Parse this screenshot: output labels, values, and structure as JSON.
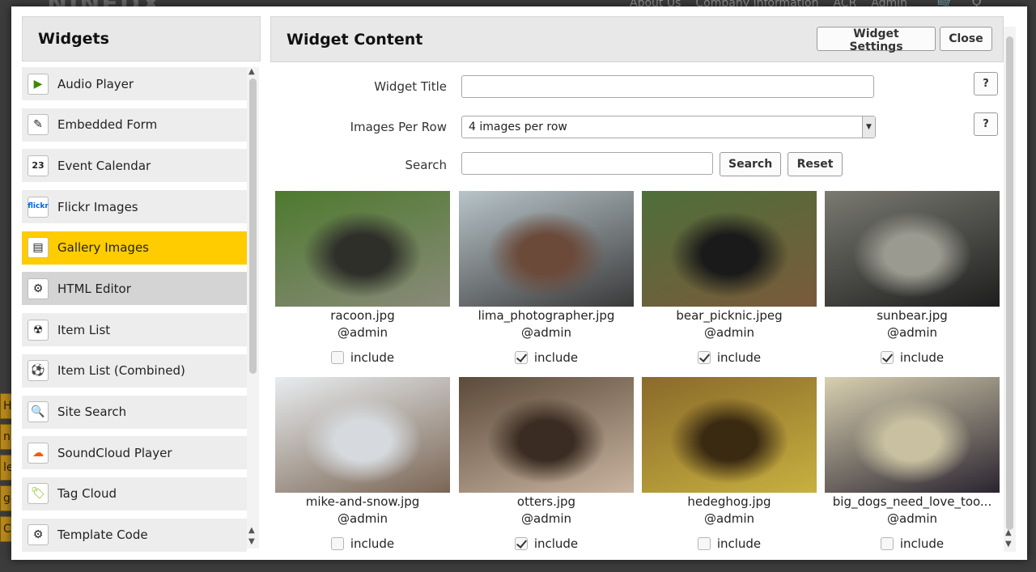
{
  "background": {
    "logo": "NINEDX",
    "nav_links": [
      "About Us",
      "Company Information",
      "ACR",
      "Admin"
    ],
    "side_tabs": [
      "H",
      "nu",
      "let",
      "ge",
      "Cl"
    ]
  },
  "left_panel": {
    "title": "Widgets",
    "items": [
      {
        "label": "Audio Player",
        "icon": "play-icon",
        "state": "normal"
      },
      {
        "label": "Embedded Form",
        "icon": "form-icon",
        "state": "normal"
      },
      {
        "label": "Event Calendar",
        "icon": "calendar-icon",
        "state": "normal"
      },
      {
        "label": "Flickr Images",
        "icon": "flickr-icon",
        "state": "normal"
      },
      {
        "label": "Gallery Images",
        "icon": "gallery-icon",
        "state": "active"
      },
      {
        "label": "HTML Editor",
        "icon": "html-editor-icon",
        "state": "hover"
      },
      {
        "label": "Item List",
        "icon": "item-list-icon",
        "state": "normal"
      },
      {
        "label": "Item List (Combined)",
        "icon": "item-list-combined-icon",
        "state": "normal"
      },
      {
        "label": "Site Search",
        "icon": "search-icon",
        "state": "normal"
      },
      {
        "label": "SoundCloud Player",
        "icon": "soundcloud-icon",
        "state": "normal"
      },
      {
        "label": "Tag Cloud",
        "icon": "tag-icon",
        "state": "normal"
      },
      {
        "label": "Template Code",
        "icon": "template-code-icon",
        "state": "normal"
      }
    ],
    "icon_glyphs": {
      "play-icon": "▶",
      "form-icon": "✎",
      "calendar-icon": "23",
      "flickr-icon": "flickr",
      "gallery-icon": "▤",
      "html-editor-icon": "⚙",
      "item-list-icon": "☢",
      "item-list-combined-icon": "⚽",
      "search-icon": "🔍",
      "soundcloud-icon": "☁",
      "tag-icon": "🏷",
      "template-code-icon": "⚙"
    }
  },
  "right_panel": {
    "title": "Widget Content",
    "settings_label": "Widget Settings",
    "close_label": "Close",
    "widget_title_label": "Widget Title",
    "widget_title_value": "",
    "images_per_row_label": "Images Per Row",
    "images_per_row_value": "4 images per row",
    "search_label": "Search",
    "search_value": "",
    "search_button": "Search",
    "reset_button": "Reset",
    "help_label": "?",
    "include_label": "include",
    "images": [
      {
        "filename": "racoon.jpg",
        "owner": "@admin",
        "included": false,
        "colors": [
          "#4d7a2e",
          "#8a8a7a",
          "#2f2f2a"
        ]
      },
      {
        "filename": "lima_photographer.jpg",
        "owner": "@admin",
        "included": true,
        "colors": [
          "#b8c4c9",
          "#3a3a3a",
          "#6c4a3a"
        ]
      },
      {
        "filename": "bear_picknic.jpeg",
        "owner": "@admin",
        "included": true,
        "colors": [
          "#4e6f3a",
          "#7a5a3a",
          "#1a1a1a"
        ]
      },
      {
        "filename": "sunbear.jpg",
        "owner": "@admin",
        "included": true,
        "colors": [
          "#7a7a72",
          "#1e1e1e",
          "#9a9a90"
        ]
      },
      {
        "filename": "mike-and-snow.jpg",
        "owner": "@admin",
        "included": false,
        "colors": [
          "#e8ecef",
          "#7a6655",
          "#d6dade"
        ]
      },
      {
        "filename": "otters.jpg",
        "owner": "@admin",
        "included": true,
        "colors": [
          "#5c4a3a",
          "#c8b4a0",
          "#3a2c22"
        ]
      },
      {
        "filename": "hedeghog.jpg",
        "owner": "@admin",
        "included": false,
        "colors": [
          "#8a6a2a",
          "#c8b040",
          "#3a2a12"
        ]
      },
      {
        "filename": "big_dogs_need_love_too...",
        "owner": "@admin",
        "included": false,
        "colors": [
          "#d8d0b0",
          "#2a2430",
          "#c8c0a0"
        ]
      }
    ]
  }
}
